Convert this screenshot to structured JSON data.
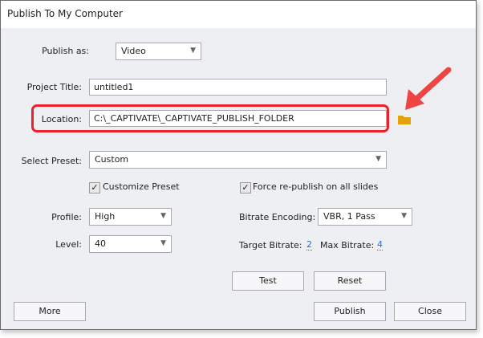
{
  "title": "Publish To My Computer",
  "publish_as": {
    "label": "Publish as:",
    "value": "Video"
  },
  "project_title": {
    "label": "Project Title:",
    "value": "untitled1"
  },
  "location": {
    "label": "Location:",
    "value": "C:\\_CAPTIVATE\\_CAPTIVATE_PUBLISH_FOLDER"
  },
  "preset": {
    "label": "Select Preset:",
    "value": "Custom"
  },
  "customize_preset": {
    "label": "Customize Preset",
    "checked": true
  },
  "force_republish": {
    "label": "Force re-publish on all slides",
    "checked": true
  },
  "profile": {
    "label": "Profile:",
    "value": "High"
  },
  "level": {
    "label": "Level:",
    "value": "40"
  },
  "bitrate_encoding": {
    "label": "Bitrate Encoding:",
    "value": "VBR, 1 Pass"
  },
  "target_bitrate": {
    "label": "Target Bitrate:",
    "value": "2"
  },
  "max_bitrate": {
    "label": "Max Bitrate:",
    "value": "4"
  },
  "buttons": {
    "test": "Test",
    "reset": "Reset",
    "more": "More",
    "publish": "Publish",
    "close": "Close"
  },
  "colors": {
    "highlight": "#e8232b",
    "folder": "#e3a20c"
  }
}
